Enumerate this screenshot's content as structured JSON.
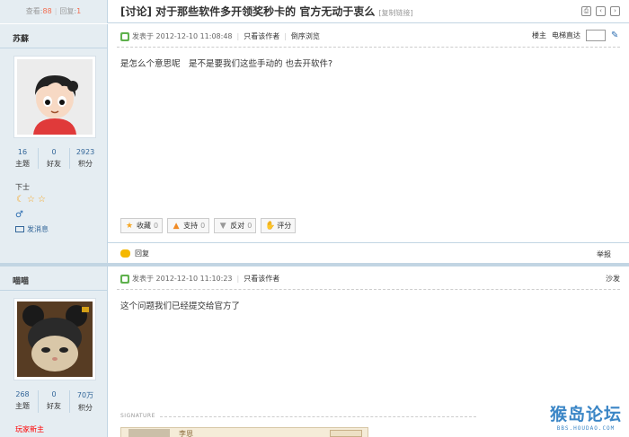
{
  "topbar": {
    "views_label": "查看:",
    "views_count": "88",
    "replies_label": "回复:",
    "replies_count": "1",
    "thread_title": "[讨论] 对于那些软件多开领奖秒卡的 官方无动于衷么",
    "copy_link": "[复制链接]"
  },
  "post1": {
    "author": "苏蘇",
    "stats": [
      {
        "value": "16",
        "label": "主题"
      },
      {
        "value": "0",
        "label": "好友"
      },
      {
        "value": "2923",
        "label": "积分"
      }
    ],
    "rank": "下士",
    "stars": [
      "☾",
      "☆",
      "☆"
    ],
    "gender_symbol": "♂",
    "send_message": "发消息",
    "meta": {
      "posted_prefix": "发表于",
      "datetime": "2012-12-10 11:08:48",
      "author_only": "只看该作者",
      "reverse": "倒序浏览"
    },
    "floor": {
      "label": "楼主",
      "jump_label": "电梯直达"
    },
    "content": "是怎么个意思呢　是不是要我们这些手动的 也去开软件?",
    "actions": [
      {
        "label": "收藏",
        "count": "0",
        "icon": "star-icon"
      },
      {
        "label": "支持",
        "count": "0",
        "icon": "thumb-up-icon"
      },
      {
        "label": "反对",
        "count": "0",
        "icon": "thumb-down-icon"
      },
      {
        "label": "评分",
        "count": "",
        "icon": "rate-icon"
      }
    ],
    "reply": "回复",
    "report": "举报"
  },
  "post2": {
    "author": "喵喵",
    "stats": [
      {
        "value": "268",
        "label": "主题"
      },
      {
        "value": "0",
        "label": "好友"
      },
      {
        "value": "70万",
        "label": "积分"
      }
    ],
    "rank": "玩家新主",
    "meta": {
      "posted_prefix": "发表于",
      "datetime": "2012-12-10 11:10:23",
      "author_only": "只看该作者"
    },
    "floor_label": "沙发",
    "content": "这个问题我们已经提交给官方了",
    "signature_label": "SIGNATURE",
    "signature_name": "李恩"
  },
  "watermark": {
    "brand": "猴岛论坛",
    "url": "BBS.HOUDAO.COM"
  },
  "colors": {
    "sidebar_bg": "#e5edf2",
    "border": "#c2d5e3",
    "accent_red": "#f26c4f",
    "link_blue": "#336699",
    "watermark_blue": "#3b86c6"
  }
}
